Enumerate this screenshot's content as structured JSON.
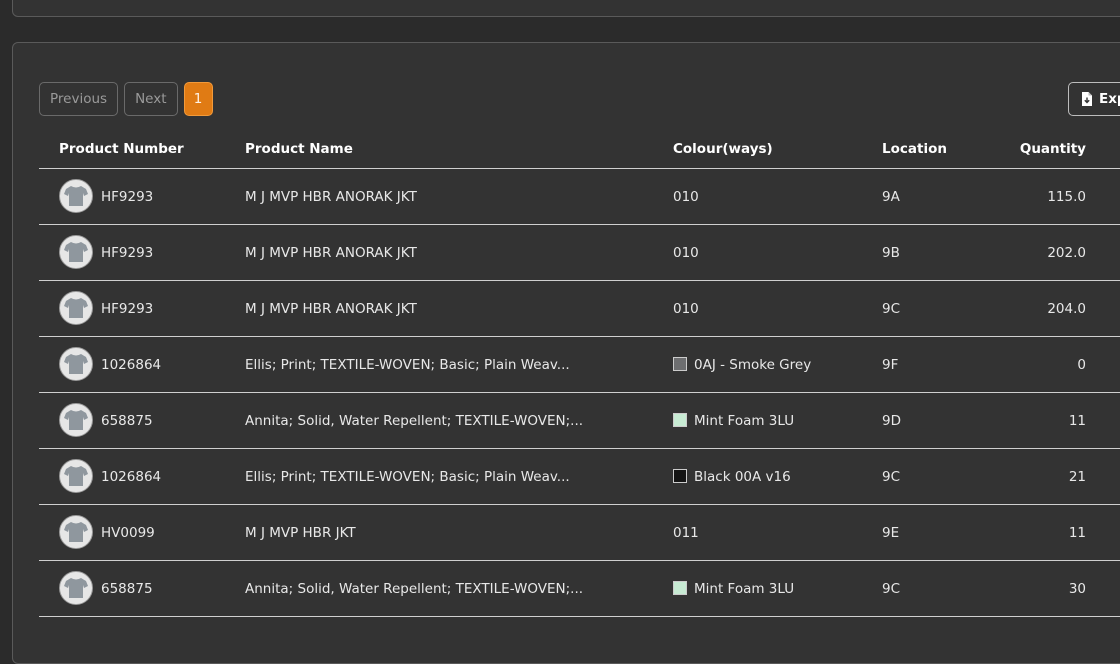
{
  "pagination": {
    "previous_label": "Previous",
    "next_label": "Next",
    "current_page": "1"
  },
  "export": {
    "label": "Exp",
    "icon": "file-download-icon"
  },
  "table": {
    "headers": {
      "product_number": "Product Number",
      "product_name": "Product Name",
      "colourways": "Colour(ways)",
      "location": "Location",
      "quantity": "Quantity"
    },
    "rows": [
      {
        "number": "HF9293",
        "name": "M J MVP HBR ANORAK JKT",
        "colour": "010",
        "swatch": "",
        "location": "9A",
        "quantity": "115.0"
      },
      {
        "number": "HF9293",
        "name": "M J MVP HBR ANORAK JKT",
        "colour": "010",
        "swatch": "",
        "location": "9B",
        "quantity": "202.0"
      },
      {
        "number": "HF9293",
        "name": "M J MVP HBR ANORAK JKT",
        "colour": "010",
        "swatch": "",
        "location": "9C",
        "quantity": "204.0"
      },
      {
        "number": "1026864",
        "name": "Ellis; Print; TEXTILE-WOVEN; Basic; Plain Weav...",
        "colour": "0AJ - Smoke Grey",
        "swatch": "#6d6e70",
        "location": "9F",
        "quantity": "0"
      },
      {
        "number": "658875",
        "name": "Annita; Solid, Water Repellent; TEXTILE-WOVEN;...",
        "colour": "Mint Foam 3LU",
        "swatch": "#c7ead3",
        "location": "9D",
        "quantity": "11"
      },
      {
        "number": "1026864",
        "name": "Ellis; Print; TEXTILE-WOVEN; Basic; Plain Weav...",
        "colour": "Black 00A v16",
        "swatch": "#141414",
        "location": "9C",
        "quantity": "21"
      },
      {
        "number": "HV0099",
        "name": "M J MVP HBR JKT",
        "colour": "011",
        "swatch": "",
        "location": "9E",
        "quantity": "11"
      },
      {
        "number": "658875",
        "name": "Annita; Solid, Water Repellent; TEXTILE-WOVEN;...",
        "colour": "Mint Foam 3LU",
        "swatch": "#c7ead3",
        "location": "9C",
        "quantity": "30"
      }
    ]
  },
  "colors": {
    "background": "#2b2b2b",
    "panel": "#333333",
    "accent": "#e07b14"
  }
}
